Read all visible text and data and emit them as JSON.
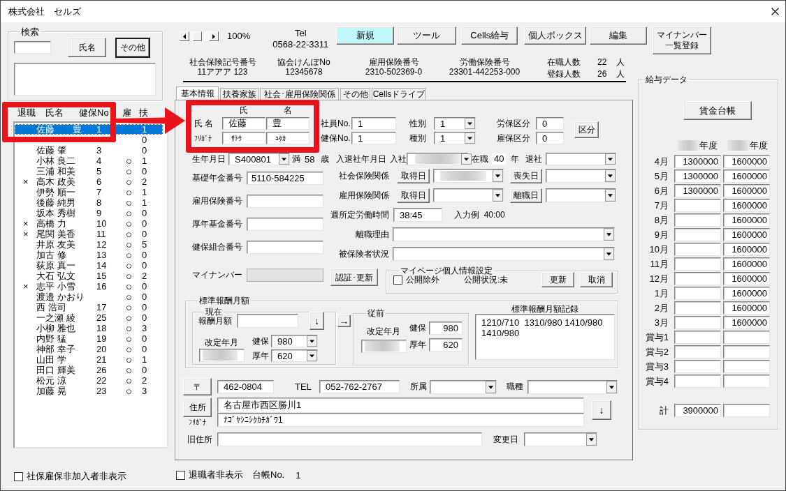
{
  "window": {
    "title": "株式会社　セルズ"
  },
  "search": {
    "legend": "検索",
    "buttons": [
      {
        "label": "氏名",
        "default": false
      },
      {
        "label": "その他",
        "default": true
      }
    ]
  },
  "employee_list": {
    "columns": [
      "退職",
      "氏名",
      "健保No",
      "雇",
      "扶"
    ],
    "rows": [
      {
        "name": "佐藤　　豊",
        "number": "1",
        "dependents": "1",
        "selected": true
      },
      {
        "dependents": "0",
        "selected": false
      },
      {
        "name": "佐藤 肇",
        "number": "3",
        "dependents": "0",
        "selected": false
      },
      {
        "name": "小林 良二",
        "number": "4",
        "insured": "○",
        "dependents": "1",
        "selected": false
      },
      {
        "name": "三浦 和美",
        "number": "5",
        "insured": "○",
        "dependents": "0",
        "selected": false
      },
      {
        "retired": "×",
        "name": "高木 政美",
        "number": "6",
        "insured": "○",
        "dependents": "2",
        "selected": false
      },
      {
        "name": "伊勢 順一",
        "number": "7",
        "insured": "○",
        "dependents": "1",
        "selected": false
      },
      {
        "name": "後藤 純男",
        "number": "8",
        "insured": "○",
        "dependents": "1",
        "selected": false
      },
      {
        "name": "坂本 秀樹",
        "number": "9",
        "insured": "○",
        "dependents": "0",
        "selected": false
      },
      {
        "retired": "×",
        "name": "高橋 力",
        "number": "10",
        "insured": "○",
        "dependents": "0",
        "selected": false
      },
      {
        "retired": "×",
        "name": "尾関 美香",
        "number": "11",
        "insured": "○",
        "dependents": "0",
        "selected": false
      },
      {
        "name": "井原 友美",
        "number": "12",
        "insured": "○",
        "dependents": "5",
        "selected": false
      },
      {
        "name": "加古 修",
        "number": "13",
        "insured": "○",
        "dependents": "0",
        "selected": false
      },
      {
        "name": "荻原 真一",
        "number": "14",
        "insured": "○",
        "dependents": "0",
        "selected": false
      },
      {
        "name": "大石 弘文",
        "number": "15",
        "insured": "○",
        "dependents": "2",
        "selected": false
      },
      {
        "retired": "×",
        "name": "志平 小雪",
        "number": "16",
        "insured": "○",
        "dependents": "0",
        "selected": false
      },
      {
        "name": "渡邉 かおり",
        "insured": "○",
        "dependents": "0",
        "selected": false
      },
      {
        "name": "西 浩司",
        "number": "17",
        "insured": "○",
        "dependents": "0",
        "selected": false
      },
      {
        "name": "一之瀬 綾",
        "number": "25",
        "insured": "○",
        "dependents": "0",
        "selected": false
      },
      {
        "name": "小柳 雅也",
        "number": "18",
        "insured": "○",
        "dependents": "3",
        "selected": false
      },
      {
        "name": "内野 猛",
        "number": "19",
        "insured": "○",
        "dependents": "0",
        "selected": false
      },
      {
        "name": "神部 幸子",
        "number": "20",
        "insured": "○",
        "dependents": "0",
        "selected": false
      },
      {
        "name": "山田 学",
        "number": "21",
        "insured": "○",
        "dependents": "1",
        "selected": false
      },
      {
        "name": "田口 輝美",
        "number": "26",
        "insured": "○",
        "dependents": "0",
        "selected": false
      },
      {
        "name": "松元 涼",
        "number": "22",
        "insured": "○",
        "dependents": "2",
        "selected": false
      },
      {
        "name": "加藤 晃",
        "number": "23",
        "insured": "○",
        "dependents": "3",
        "selected": false
      }
    ]
  },
  "hide_uninsured": {
    "label": "社保雇保非加入者非表示",
    "checked": false
  },
  "toolbar": {
    "zoom": "100%",
    "tel_label": "Tel",
    "tel": "0568-22-3311",
    "buttons": [
      {
        "label": "新規",
        "highlighted": true
      },
      {
        "label": "ツール",
        "highlighted": false
      },
      {
        "label": "Cells給与",
        "highlighted": false
      },
      {
        "label": "個人ボックス",
        "highlighted": false
      },
      {
        "label": "編集",
        "highlighted": false
      },
      {
        "label": "マイナンバー一覧登録",
        "highlighted": false
      }
    ]
  },
  "company_info": [
    {
      "label": "社会保険記号番号",
      "value": "11アアア 123"
    },
    {
      "label": "協会けんぽNo",
      "value": "12345678"
    },
    {
      "label": "雇用保険番号",
      "value": "2310-502369-0"
    },
    {
      "label": "労働保険番号",
      "value": "23301-442253-000"
    }
  ],
  "headcount": [
    {
      "label": "在職人数",
      "value": "22",
      "unit": "人"
    },
    {
      "label": "登録人数",
      "value": "26",
      "unit": "人"
    }
  ],
  "tabs": [
    {
      "label": "基本情報",
      "selected": true
    },
    {
      "label": "扶養家族",
      "selected": false
    },
    {
      "label": "社会･雇用保険関係",
      "selected": false
    },
    {
      "label": "その他",
      "selected": false
    },
    {
      "label": "Cellsドライブ",
      "selected": false
    }
  ],
  "basic_info": {
    "name": {
      "column_headers": [
        "氏",
        "名"
      ],
      "label": "氏 名",
      "kana_label": "ﾌﾘｶﾞﾅ",
      "surname": "佐藤",
      "given_name": "豊",
      "surname_kana": "ｻﾄｳ",
      "given_name_kana": "ﾕﾀｶ"
    },
    "numbers": [
      {
        "label": "社員No.",
        "value": "1"
      },
      {
        "label": "健保No.",
        "value": "1"
      }
    ],
    "codes": [
      {
        "label": "性別",
        "value": "1"
      },
      {
        "label": "種別",
        "value": "1"
      }
    ],
    "divisions": [
      {
        "label": "労保区分",
        "value": "0"
      },
      {
        "label": "雇保区分",
        "value": "0"
      }
    ],
    "division_button": "区分",
    "birth": {
      "label": "生年月日",
      "value": "S400801",
      "age_prefix": "満",
      "age": "58",
      "age_unit": "歳"
    },
    "dates": {
      "label": "入退社年月日",
      "hire_label": "入社",
      "hire_redacted": true,
      "tenure_label": "在職",
      "tenure": "40",
      "tenure_unit": "年",
      "leave_label": "退社"
    },
    "id_fields": [
      {
        "label": "基礎年金番号",
        "value": "5110-584225",
        "disabled": false
      },
      {
        "label": "雇用保険番号",
        "disabled": false
      },
      {
        "label": "厚年基金番号",
        "disabled": false
      },
      {
        "label": "健保組合番号",
        "disabled": false
      },
      {
        "label": "マイナンバー",
        "disabled": true
      }
    ],
    "insurance": [
      {
        "label": "社会保険関係",
        "acquired_button": "取得日",
        "acquired_redacted": true,
        "lost_button": "喪失日"
      },
      {
        "label": "雇用保険関係",
        "acquired_button": "取得日",
        "acquired_redacted": false,
        "lost_button": "離職日"
      }
    ],
    "weekly_hours": {
      "label": "週所定労働時間",
      "value": "38:45",
      "hint": "入力例  40:00"
    },
    "selects": [
      {
        "label": "離職理由"
      },
      {
        "label": "被保険者状況"
      }
    ],
    "verify_button": "認証･更新",
    "my_page": {
      "legend": "マイページ個人情報設定",
      "exclude": {
        "label": "公開除外",
        "checked": false
      },
      "status": "公開状況:未",
      "buttons": [
        "更新",
        "取消"
      ]
    },
    "standard_pay": {
      "legend": "標準報酬月額",
      "current": {
        "legend": "現在",
        "pay_label": "報酬月額",
        "down_button": "↓",
        "revision_label": "改定年月",
        "revision_redacted": true,
        "grades": [
          {
            "label": "健保",
            "value": "980"
          },
          {
            "label": "厚年",
            "value": "620"
          }
        ]
      },
      "copy_button": "→",
      "previous": {
        "legend": "従前",
        "revision_label": "改定年月",
        "revision_redacted": true,
        "grades": [
          {
            "label": "健保",
            "value": "980"
          },
          {
            "label": "厚年",
            "value": "620"
          }
        ]
      },
      "history": {
        "title": "標準報酬月額記録",
        "lines": [
          "1210/710  1310/980 1410/980",
          "1410/980"
        ]
      }
    },
    "contact": {
      "zip_button": "〒",
      "zip": "462-0804",
      "tel_label": "TEL",
      "tel": "052-762-2767",
      "department_label": "所属",
      "job_label": "職種",
      "address_button": "住所",
      "kana_label": "ﾌﾘｶﾞﾅ",
      "address": "名古屋市西区勝川1",
      "address_kana": "ﾅｺﾞﾔｼﾆｼｸｶﾁｶﾞﾜ1",
      "down_button": "↓",
      "old_address_label": "旧住所",
      "changed_label": "変更日"
    }
  },
  "bottom_bar": {
    "hide_retired": {
      "label": "退職者非表示",
      "checked": false
    },
    "ledger_label": "台帳No.",
    "ledger": "1"
  },
  "pay_data": {
    "legend": "給与データ",
    "ledger_button": "賃金台帳",
    "years": [
      {
        "label": "年度",
        "redacted": true
      },
      {
        "label": "年度",
        "redacted": true
      }
    ],
    "months": [
      {
        "label": "4月",
        "first": "1300000",
        "second": "1600000"
      },
      {
        "label": "5月",
        "first": "1300000",
        "second": "1600000"
      },
      {
        "label": "6月",
        "first": "1300000",
        "second": "1600000"
      },
      {
        "label": "7月",
        "second": "1600000"
      },
      {
        "label": "8月",
        "second": "1600000"
      },
      {
        "label": "9月",
        "second": "1600000"
      },
      {
        "label": "10月",
        "second": "1600000"
      },
      {
        "label": "11月",
        "second": "1600000"
      },
      {
        "label": "12月",
        "second": "1600000"
      },
      {
        "label": "1月",
        "second": "1600000"
      },
      {
        "label": "2月",
        "second": "1600000"
      },
      {
        "label": "3月",
        "second": "1600000"
      },
      {
        "label": "賞与1"
      },
      {
        "label": "賞与2"
      },
      {
        "label": "賞与3"
      },
      {
        "label": "賞与4"
      }
    ],
    "total": {
      "label": "計",
      "first": "3900000"
    }
  },
  "annotations": [
    {
      "kind": "frame"
    },
    {
      "kind": "frame"
    },
    {
      "kind": "arrow"
    }
  ]
}
